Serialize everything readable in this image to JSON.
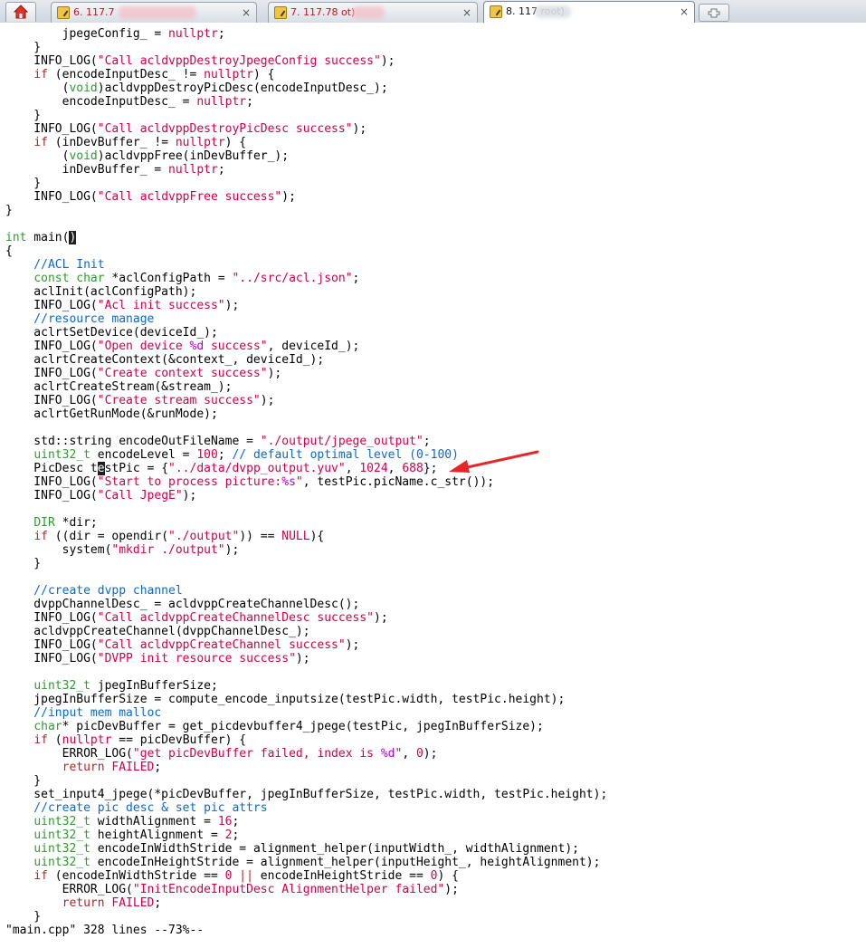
{
  "tabs": [
    {
      "label": "6. 117.7",
      "close": "×",
      "active": false
    },
    {
      "label": "7. 117.78 ot)",
      "close": "×",
      "active": false
    },
    {
      "label": "8. 117 root)",
      "close": "×",
      "active": true
    }
  ],
  "icons": {
    "home": "home-icon",
    "tab": "wrench-icon",
    "new_tab": "plus-icon",
    "annotation": "red-arrow"
  },
  "colors": {
    "keyword": "#a52a2a",
    "string": "#d1004c",
    "comment": "#0d68c9",
    "type": "#2f9a2f",
    "format": "#b000d6",
    "arrow": "#e8262a"
  },
  "code": [
    {
      "tokens": [
        {
          "c": "t",
          "v": "        jpegeConfig_ = "
        },
        {
          "c": "s",
          "v": "nullptr"
        },
        {
          "c": "t",
          "v": ";"
        }
      ]
    },
    {
      "tokens": [
        {
          "c": "t",
          "v": "    }"
        }
      ]
    },
    {
      "tokens": [
        {
          "c": "t",
          "v": "    INFO_LOG("
        },
        {
          "c": "s",
          "v": "\"Call acldvppDestroyJpegeConfig success\""
        },
        {
          "c": "t",
          "v": ");"
        }
      ]
    },
    {
      "tokens": [
        {
          "c": "t",
          "v": "    "
        },
        {
          "c": "k",
          "v": "if"
        },
        {
          "c": "t",
          "v": " (encodeInputDesc_ != "
        },
        {
          "c": "s",
          "v": "nullptr"
        },
        {
          "c": "t",
          "v": ") {"
        }
      ]
    },
    {
      "tokens": [
        {
          "c": "t",
          "v": "        ("
        },
        {
          "c": "ty",
          "v": "void"
        },
        {
          "c": "t",
          "v": ")acldvppDestroyPicDesc(encodeInputDesc_);"
        }
      ]
    },
    {
      "tokens": [
        {
          "c": "t",
          "v": "        encodeInputDesc_ = "
        },
        {
          "c": "s",
          "v": "nullptr"
        },
        {
          "c": "t",
          "v": ";"
        }
      ]
    },
    {
      "tokens": [
        {
          "c": "t",
          "v": "    }"
        }
      ]
    },
    {
      "tokens": [
        {
          "c": "t",
          "v": "    INFO_LOG("
        },
        {
          "c": "s",
          "v": "\"Call acldvppDestroyPicDesc success\""
        },
        {
          "c": "t",
          "v": ");"
        }
      ]
    },
    {
      "tokens": [
        {
          "c": "t",
          "v": "    "
        },
        {
          "c": "k",
          "v": "if"
        },
        {
          "c": "t",
          "v": " (inDevBuffer_ != "
        },
        {
          "c": "s",
          "v": "nullptr"
        },
        {
          "c": "t",
          "v": ") {"
        }
      ]
    },
    {
      "tokens": [
        {
          "c": "t",
          "v": "        ("
        },
        {
          "c": "ty",
          "v": "void"
        },
        {
          "c": "t",
          "v": ")acldvppFree(inDevBuffer_);"
        }
      ]
    },
    {
      "tokens": [
        {
          "c": "t",
          "v": "        inDevBuffer_ = "
        },
        {
          "c": "s",
          "v": "nullptr"
        },
        {
          "c": "t",
          "v": ";"
        }
      ]
    },
    {
      "tokens": [
        {
          "c": "t",
          "v": "    }"
        }
      ]
    },
    {
      "tokens": [
        {
          "c": "t",
          "v": "    INFO_LOG("
        },
        {
          "c": "s",
          "v": "\"Call acldvppFree success\""
        },
        {
          "c": "t",
          "v": ");"
        }
      ]
    },
    {
      "tokens": [
        {
          "c": "t",
          "v": "}"
        }
      ]
    },
    {
      "tokens": []
    },
    {
      "tokens": [
        {
          "c": "ty",
          "v": "int"
        },
        {
          "c": "t",
          "v": " main("
        },
        {
          "c": "cursor",
          "v": ")"
        }
      ]
    },
    {
      "tokens": [
        {
          "c": "t",
          "v": "{"
        }
      ]
    },
    {
      "tokens": [
        {
          "c": "c",
          "v": "    //ACL Init"
        }
      ]
    },
    {
      "tokens": [
        {
          "c": "t",
          "v": "    "
        },
        {
          "c": "ty",
          "v": "const char"
        },
        {
          "c": "t",
          "v": " *aclConfigPath = "
        },
        {
          "c": "s",
          "v": "\"../src/acl.json\""
        },
        {
          "c": "t",
          "v": ";"
        }
      ]
    },
    {
      "tokens": [
        {
          "c": "t",
          "v": "    aclInit(aclConfigPath);"
        }
      ]
    },
    {
      "tokens": [
        {
          "c": "t",
          "v": "    INFO_LOG("
        },
        {
          "c": "s",
          "v": "\"Acl init success\""
        },
        {
          "c": "t",
          "v": ");"
        }
      ]
    },
    {
      "tokens": [
        {
          "c": "c",
          "v": "    //resource manage"
        }
      ]
    },
    {
      "tokens": [
        {
          "c": "t",
          "v": "    aclrtSetDevice(deviceId_);"
        }
      ]
    },
    {
      "tokens": [
        {
          "c": "t",
          "v": "    INFO_LOG("
        },
        {
          "c": "s",
          "v": "\"Open device "
        },
        {
          "c": "fmt",
          "v": "%d"
        },
        {
          "c": "s",
          "v": " success\""
        },
        {
          "c": "t",
          "v": ", deviceId_);"
        }
      ]
    },
    {
      "tokens": [
        {
          "c": "t",
          "v": "    aclrtCreateContext(&context_, deviceId_);"
        }
      ]
    },
    {
      "tokens": [
        {
          "c": "t",
          "v": "    INFO_LOG("
        },
        {
          "c": "s",
          "v": "\"Create context success\""
        },
        {
          "c": "t",
          "v": ");"
        }
      ]
    },
    {
      "tokens": [
        {
          "c": "t",
          "v": "    aclrtCreateStream(&stream_);"
        }
      ]
    },
    {
      "tokens": [
        {
          "c": "t",
          "v": "    INFO_LOG("
        },
        {
          "c": "s",
          "v": "\"Create stream success\""
        },
        {
          "c": "t",
          "v": ");"
        }
      ]
    },
    {
      "tokens": [
        {
          "c": "t",
          "v": "    aclrtGetRunMode(&runMode);"
        }
      ]
    },
    {
      "tokens": []
    },
    {
      "tokens": [
        {
          "c": "t",
          "v": "    std::string encodeOutFileName = "
        },
        {
          "c": "s",
          "v": "\"./output/jpege_output\""
        },
        {
          "c": "t",
          "v": ";"
        }
      ]
    },
    {
      "tokens": [
        {
          "c": "t",
          "v": "    "
        },
        {
          "c": "ty",
          "v": "uint32_t"
        },
        {
          "c": "t",
          "v": " encodeLevel = "
        },
        {
          "c": "n",
          "v": "100"
        },
        {
          "c": "t",
          "v": "; "
        },
        {
          "c": "c",
          "v": "// default optimal level (0-100)"
        }
      ]
    },
    {
      "tokens": [
        {
          "c": "t",
          "v": "    PicDesc t"
        },
        {
          "c": "cursor",
          "v": "e"
        },
        {
          "c": "t",
          "v": "stPic = {"
        },
        {
          "c": "s",
          "v": "\"../data/dvpp_output.yuv\""
        },
        {
          "c": "t",
          "v": ", "
        },
        {
          "c": "n",
          "v": "1024"
        },
        {
          "c": "t",
          "v": ", "
        },
        {
          "c": "n",
          "v": "688"
        },
        {
          "c": "t",
          "v": "};"
        }
      ]
    },
    {
      "tokens": [
        {
          "c": "t",
          "v": "    INFO_LOG("
        },
        {
          "c": "s",
          "v": "\"Start to process picture:"
        },
        {
          "c": "fmt",
          "v": "%s"
        },
        {
          "c": "s",
          "v": "\""
        },
        {
          "c": "t",
          "v": ", testPic.picName.c_str());"
        }
      ]
    },
    {
      "tokens": [
        {
          "c": "t",
          "v": "    INFO_LOG("
        },
        {
          "c": "s",
          "v": "\"Call JpegE\""
        },
        {
          "c": "t",
          "v": ");"
        }
      ]
    },
    {
      "tokens": []
    },
    {
      "tokens": [
        {
          "c": "t",
          "v": "    "
        },
        {
          "c": "ty",
          "v": "DIR"
        },
        {
          "c": "t",
          "v": " *dir;"
        }
      ]
    },
    {
      "tokens": [
        {
          "c": "t",
          "v": "    "
        },
        {
          "c": "k",
          "v": "if"
        },
        {
          "c": "t",
          "v": " ((dir = opendir("
        },
        {
          "c": "s",
          "v": "\"./output\""
        },
        {
          "c": "t",
          "v": ")) == "
        },
        {
          "c": "s",
          "v": "NULL"
        },
        {
          "c": "t",
          "v": "){"
        }
      ]
    },
    {
      "tokens": [
        {
          "c": "t",
          "v": "        system("
        },
        {
          "c": "s",
          "v": "\"mkdir ./output\""
        },
        {
          "c": "t",
          "v": ");"
        }
      ]
    },
    {
      "tokens": [
        {
          "c": "t",
          "v": "    }"
        }
      ]
    },
    {
      "tokens": []
    },
    {
      "tokens": [
        {
          "c": "c",
          "v": "    //create dvpp channel"
        }
      ]
    },
    {
      "tokens": [
        {
          "c": "t",
          "v": "    dvppChannelDesc_ = acldvppCreateChannelDesc();"
        }
      ]
    },
    {
      "tokens": [
        {
          "c": "t",
          "v": "    INFO_LOG("
        },
        {
          "c": "s",
          "v": "\"Call acldvppCreateChannelDesc success\""
        },
        {
          "c": "t",
          "v": ");"
        }
      ]
    },
    {
      "tokens": [
        {
          "c": "t",
          "v": "    acldvppCreateChannel(dvppChannelDesc_);"
        }
      ]
    },
    {
      "tokens": [
        {
          "c": "t",
          "v": "    INFO_LOG("
        },
        {
          "c": "s",
          "v": "\"Call acldvppCreateChannel success\""
        },
        {
          "c": "t",
          "v": ");"
        }
      ]
    },
    {
      "tokens": [
        {
          "c": "t",
          "v": "    INFO_LOG("
        },
        {
          "c": "s",
          "v": "\"DVPP init resource success\""
        },
        {
          "c": "t",
          "v": ");"
        }
      ]
    },
    {
      "tokens": []
    },
    {
      "tokens": [
        {
          "c": "t",
          "v": "    "
        },
        {
          "c": "ty",
          "v": "uint32_t"
        },
        {
          "c": "t",
          "v": " jpegInBufferSize;"
        }
      ]
    },
    {
      "tokens": [
        {
          "c": "t",
          "v": "    jpegInBufferSize = compute_encode_inputsize(testPic.width, testPic.height);"
        }
      ]
    },
    {
      "tokens": [
        {
          "c": "c",
          "v": "    //input mem malloc"
        }
      ]
    },
    {
      "tokens": [
        {
          "c": "t",
          "v": "    "
        },
        {
          "c": "ty",
          "v": "char"
        },
        {
          "c": "t",
          "v": "* picDevBuffer = get_picdevbuffer4_jpege(testPic, jpegInBufferSize);"
        }
      ]
    },
    {
      "tokens": [
        {
          "c": "t",
          "v": "    "
        },
        {
          "c": "k",
          "v": "if"
        },
        {
          "c": "t",
          "v": " ("
        },
        {
          "c": "s",
          "v": "nullptr"
        },
        {
          "c": "t",
          "v": " == picDevBuffer) {"
        }
      ]
    },
    {
      "tokens": [
        {
          "c": "t",
          "v": "        ERROR_LOG("
        },
        {
          "c": "s",
          "v": "\"get picDevBuffer failed, index is "
        },
        {
          "c": "fmt",
          "v": "%d"
        },
        {
          "c": "s",
          "v": "\""
        },
        {
          "c": "t",
          "v": ", "
        },
        {
          "c": "n",
          "v": "0"
        },
        {
          "c": "t",
          "v": ");"
        }
      ]
    },
    {
      "tokens": [
        {
          "c": "t",
          "v": "        "
        },
        {
          "c": "k",
          "v": "return"
        },
        {
          "c": "t",
          "v": " "
        },
        {
          "c": "s",
          "v": "FAILED"
        },
        {
          "c": "t",
          "v": ";"
        }
      ]
    },
    {
      "tokens": [
        {
          "c": "t",
          "v": "    }"
        }
      ]
    },
    {
      "tokens": [
        {
          "c": "t",
          "v": "    set_input4_jpege(*picDevBuffer, jpegInBufferSize, testPic.width, testPic.height);"
        }
      ]
    },
    {
      "tokens": [
        {
          "c": "c",
          "v": "    //create pic desc & set pic attrs"
        }
      ]
    },
    {
      "tokens": [
        {
          "c": "t",
          "v": "    "
        },
        {
          "c": "ty",
          "v": "uint32_t"
        },
        {
          "c": "t",
          "v": " widthAlignment = "
        },
        {
          "c": "n",
          "v": "16"
        },
        {
          "c": "t",
          "v": ";"
        }
      ]
    },
    {
      "tokens": [
        {
          "c": "t",
          "v": "    "
        },
        {
          "c": "ty",
          "v": "uint32_t"
        },
        {
          "c": "t",
          "v": " heightAlignment = "
        },
        {
          "c": "n",
          "v": "2"
        },
        {
          "c": "t",
          "v": ";"
        }
      ]
    },
    {
      "tokens": [
        {
          "c": "t",
          "v": "    "
        },
        {
          "c": "ty",
          "v": "uint32_t"
        },
        {
          "c": "t",
          "v": " encodeInWidthStride = alignment_helper(inputWidth_, widthAlignment);"
        }
      ]
    },
    {
      "tokens": [
        {
          "c": "t",
          "v": "    "
        },
        {
          "c": "ty",
          "v": "uint32_t"
        },
        {
          "c": "t",
          "v": " encodeInHeightStride = alignment_helper(inputHeight_, heightAlignment);"
        }
      ]
    },
    {
      "tokens": [
        {
          "c": "t",
          "v": "    "
        },
        {
          "c": "k",
          "v": "if"
        },
        {
          "c": "t",
          "v": " (encodeInWidthStride == "
        },
        {
          "c": "n",
          "v": "0"
        },
        {
          "c": "t",
          "v": " "
        },
        {
          "c": "k",
          "v": "||"
        },
        {
          "c": "t",
          "v": " encodeInHeightStride == "
        },
        {
          "c": "n",
          "v": "0"
        },
        {
          "c": "t",
          "v": ") {"
        }
      ]
    },
    {
      "tokens": [
        {
          "c": "t",
          "v": "        ERROR_LOG("
        },
        {
          "c": "s",
          "v": "\"InitEncodeInputDesc AlignmentHelper failed\""
        },
        {
          "c": "t",
          "v": ");"
        }
      ]
    },
    {
      "tokens": [
        {
          "c": "t",
          "v": "        "
        },
        {
          "c": "k",
          "v": "return"
        },
        {
          "c": "t",
          "v": " "
        },
        {
          "c": "s",
          "v": "FAILED"
        },
        {
          "c": "t",
          "v": ";"
        }
      ]
    },
    {
      "tokens": [
        {
          "c": "t",
          "v": "    }"
        }
      ]
    }
  ],
  "status_line": "\"main.cpp\" 328 lines --73%--"
}
